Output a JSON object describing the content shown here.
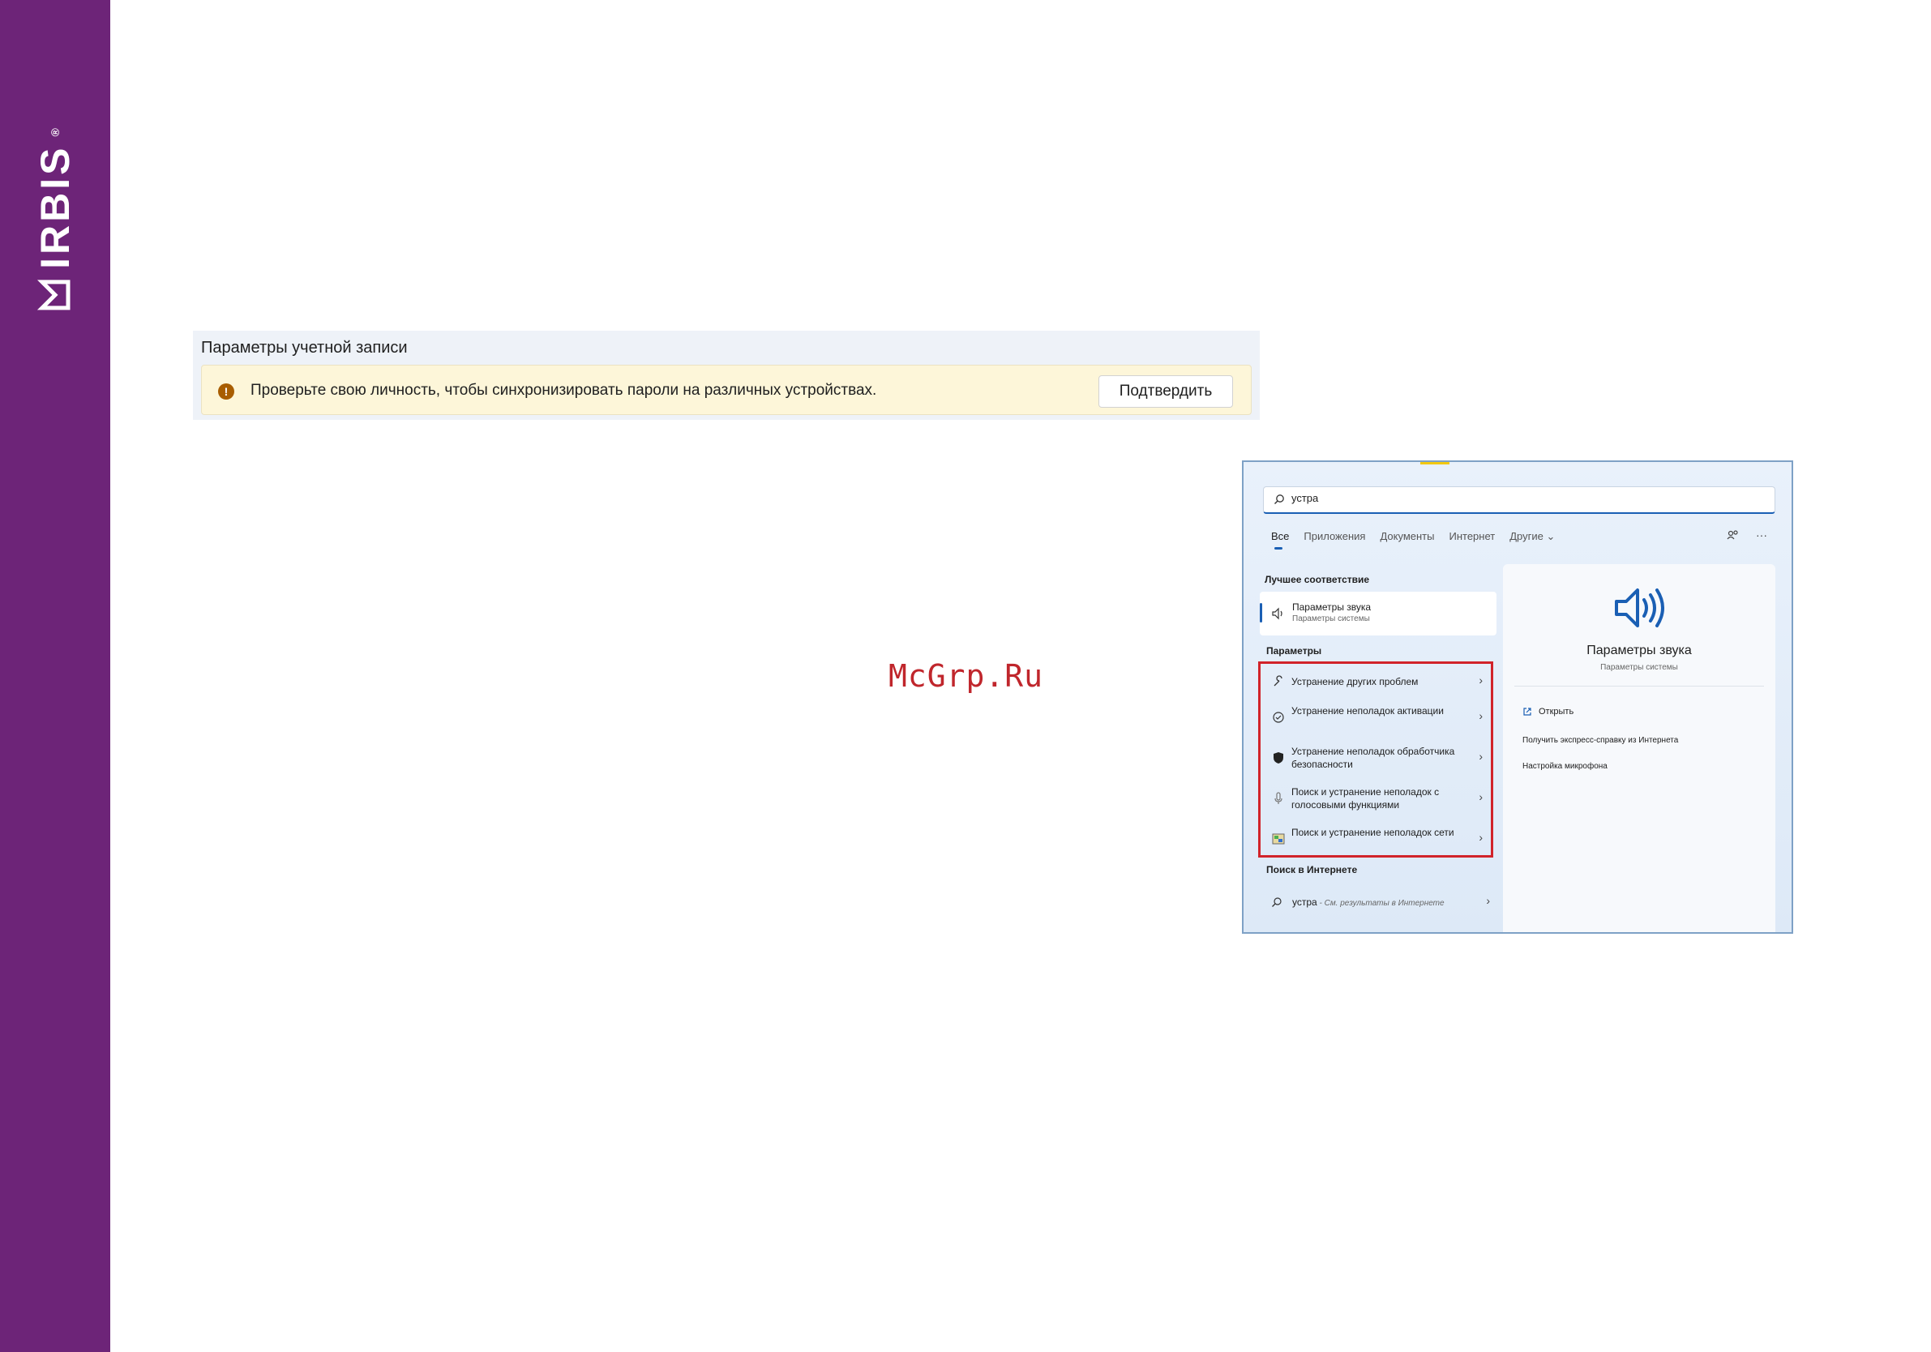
{
  "brand": {
    "name": "IRBIS",
    "mark": "®",
    "color": "#6d2478"
  },
  "account": {
    "title": "Параметры учетной записи",
    "notice_icon": "!",
    "notice_text": "Проверьте свою личность, чтобы синхронизировать пароли на различных устройствах.",
    "confirm_label": "Подтвердить"
  },
  "watermark": "McGrp.Ru",
  "search": {
    "query": "устра",
    "tabs": [
      "Все",
      "Приложения",
      "Документы",
      "Интернет",
      "Другие ⌄"
    ],
    "active_tab": "Все",
    "top_icons": [
      "share-icon",
      "more-icon"
    ],
    "more_glyph": "···",
    "best_match_label": "Лучшее соответствие",
    "best_match": {
      "title": "Параметры звука",
      "subtitle": "Параметры системы",
      "icon": "speaker-icon"
    },
    "settings_label": "Параметры",
    "settings_items": [
      {
        "label": "Устранение других проблем",
        "icon": "wrench-icon"
      },
      {
        "label": "Устранение неполадок активации",
        "icon": "check-circle-icon"
      },
      {
        "label": "Устранение неполадок обработчика безопасности",
        "icon": "shield-icon"
      },
      {
        "label": "Поиск и устранение неполадок с голосовыми функциями",
        "icon": "microphone-icon"
      },
      {
        "label": "Поиск и устранение неполадок сети",
        "icon": "network-icon"
      }
    ],
    "web_label": "Поиск в Интернете",
    "web_item": {
      "query": "устра",
      "suffix": " - См. результаты в Интернете"
    },
    "detail": {
      "title": "Параметры звука",
      "subtitle": "Параметры системы",
      "open_label": "Открыть",
      "links": [
        "Получить экспресс-справку из Интернета",
        "Настройка микрофона"
      ]
    },
    "highlight_color": "#d1232a"
  }
}
